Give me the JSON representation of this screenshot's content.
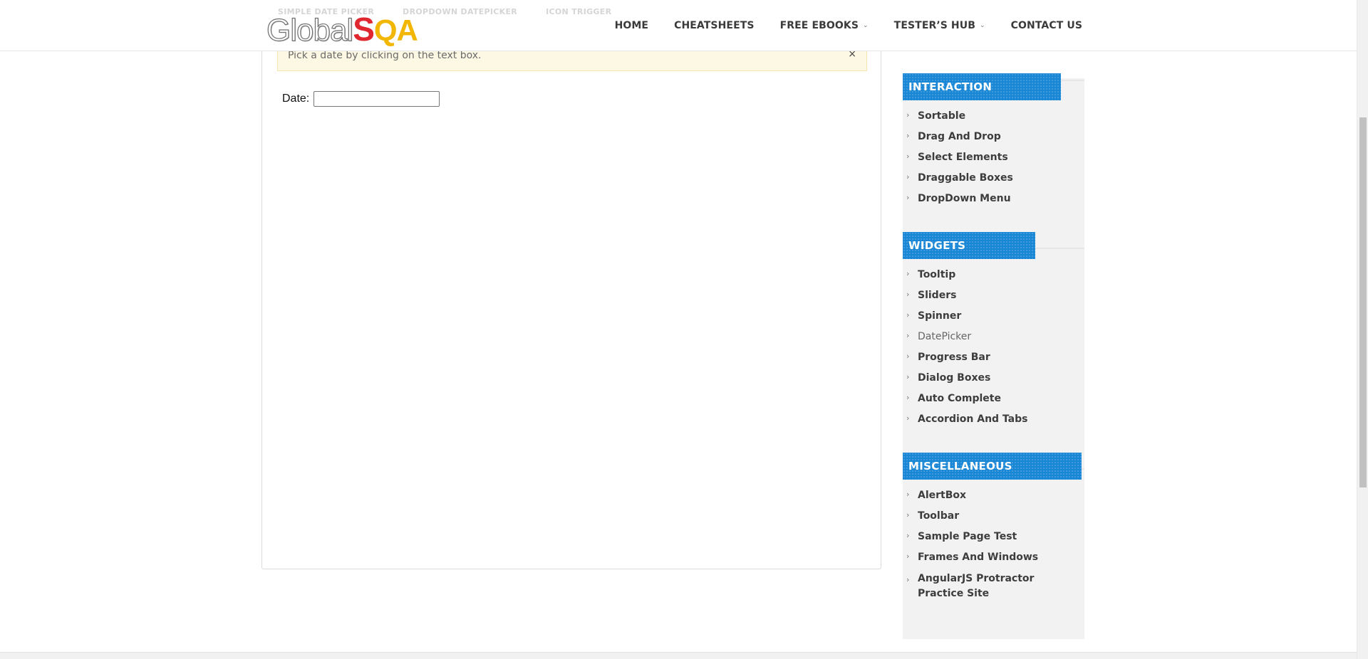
{
  "header": {
    "logo": {
      "part1": "Global",
      "part2": "S",
      "part3": "QA"
    },
    "nav": [
      {
        "label": "HOME",
        "has_dropdown": false
      },
      {
        "label": "CHEATSHEETS",
        "has_dropdown": false
      },
      {
        "label": "FREE EBOOKS",
        "has_dropdown": true
      },
      {
        "label": "TESTER’S HUB",
        "has_dropdown": true
      },
      {
        "label": "CONTACT US",
        "has_dropdown": false
      }
    ],
    "faded_tabs": [
      "SIMPLE DATE PICKER",
      "DROPDOWN DATEPICKER",
      "ICON TRIGGER"
    ]
  },
  "main": {
    "alert_text": "Pick a date by clicking on the text box.",
    "alert_close": "×",
    "date_label": "Date:",
    "date_value": ""
  },
  "sidebar": {
    "sections": [
      {
        "title": "INTERACTION",
        "items": [
          "Sortable",
          "Drag And Drop",
          "Select Elements",
          "Draggable Boxes",
          "DropDown Menu"
        ]
      },
      {
        "title": "WIDGETS",
        "items": [
          "Tooltip",
          "Sliders",
          "Spinner",
          "DatePicker",
          "Progress Bar",
          "Dialog Boxes",
          "Auto Complete",
          "Accordion And Tabs"
        ]
      },
      {
        "title": "MISCELLANEOUS",
        "items": [
          "AlertBox",
          "Toolbar",
          "Sample Page Test",
          "Frames And Windows",
          "AngularJS Protractor Practice Site"
        ]
      }
    ]
  },
  "colors": {
    "accent": "#1a86d6",
    "alert_bg": "#fcf8e3",
    "logo_red": "#e0262e",
    "logo_yellow": "#f2b705"
  }
}
